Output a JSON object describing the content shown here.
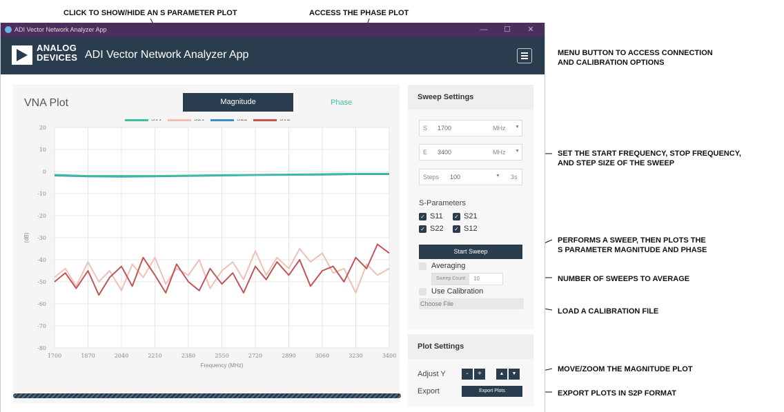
{
  "callouts": {
    "show_hide": "CLICK TO SHOW/HIDE AN S PARAMETER PLOT",
    "phase": "ACCESS THE PHASE PLOT",
    "menu": [
      "MENU BUTTON TO ACCESS CONNECTION",
      "AND CALIBRATION OPTIONS"
    ],
    "sweep_range": [
      "SET THE START FREQUENCY, STOP FREQUENCY,",
      "AND STEP SIZE OF THE SWEEP"
    ],
    "start_sweep": [
      "PERFORMS A SWEEP, THEN PLOTS THE",
      "S PARAMETER MAGNITUDE AND PHASE"
    ],
    "sweep_count": "NUMBER OF SWEEPS TO AVERAGE",
    "calibration": "LOAD A CALIBRATION FILE",
    "adjust_y": "MOVE/ZOOM THE MAGNITUDE PLOT",
    "export": "EXPORT PLOTS IN S2P FORMAT"
  },
  "window": {
    "title": "ADI Vector Network Analyzer App",
    "controls": {
      "minimize": "—",
      "maximize": "☐",
      "close": "✕"
    }
  },
  "header": {
    "logo_line1": "ANALOG",
    "logo_line2": "DEVICES",
    "title": "ADI Vector Network Analyzer App"
  },
  "plot": {
    "title": "VNA Plot",
    "tabs": {
      "magnitude": "Magnitude",
      "phase": "Phase"
    }
  },
  "sweep_settings": {
    "title": "Sweep Settings",
    "start": {
      "prefix": "S",
      "value": "1700",
      "unit": "MHz"
    },
    "end": {
      "prefix": "E",
      "value": "3400",
      "unit": "MHz"
    },
    "steps": {
      "prefix": "Steps",
      "value": "100",
      "time": "3s"
    },
    "sparams_label": "S-Parameters",
    "sparams": [
      "S11",
      "S21",
      "S22",
      "S12"
    ],
    "start_sweep": "Start Sweep",
    "averaging": "Averaging",
    "sweep_count_label": "Sweep Count",
    "sweep_count_value": "10",
    "use_calibration": "Use Calibration",
    "choose_file": "Choose File"
  },
  "plot_settings": {
    "title": "Plot Settings",
    "adjust_y": "Adjust Y",
    "export": "Export",
    "export_button": "Export Plots",
    "minus": "-",
    "plus": "+",
    "up": "▲",
    "down": "▼"
  },
  "colors": {
    "S11": "#3bbf9f",
    "S21": "#eec0b6",
    "S22": "#3a8fc9",
    "S12": "#c25454",
    "header": "#2a3d4f",
    "titlebar": "#4d2d5d",
    "phase_tab": "#3bbf9f"
  },
  "chart_data": {
    "type": "line",
    "xlabel": "Frequency (MHz)",
    "ylabel": "(dB)",
    "x_ticks": [
      1700,
      1870,
      2040,
      2210,
      2380,
      2550,
      2720,
      2890,
      3060,
      3230,
      3400
    ],
    "y_ticks": [
      20,
      10,
      0,
      -10,
      -20,
      -30,
      -40,
      -50,
      -60,
      -70,
      -80
    ],
    "xlim": [
      1700,
      3400
    ],
    "ylim": [
      -80,
      20
    ],
    "grid": true,
    "legend_position": "top",
    "series": [
      {
        "name": "S11",
        "color": "#3bbf9f",
        "x": [
          1700,
          1870,
          2040,
          2210,
          2380,
          2550,
          2720,
          2890,
          3060,
          3230,
          3400
        ],
        "y": [
          -1.5,
          -2,
          -2,
          -2,
          -1.8,
          -1.6,
          -1.5,
          -1.3,
          -1.2,
          -1,
          -1
        ]
      },
      {
        "name": "S21",
        "color": "#eec0b6",
        "x": [
          1700,
          1755,
          1810,
          1870,
          1925,
          1980,
          2040,
          2095,
          2150,
          2210,
          2265,
          2320,
          2380,
          2435,
          2490,
          2550,
          2605,
          2660,
          2720,
          2775,
          2830,
          2890,
          2945,
          3000,
          3060,
          3115,
          3170,
          3230,
          3285,
          3340,
          3400
        ],
        "y": [
          -48,
          -44,
          -52,
          -41,
          -50,
          -45,
          -54,
          -42,
          -48,
          -39,
          -51,
          -44,
          -47,
          -40,
          -53,
          -45,
          -41,
          -49,
          -36,
          -47,
          -39,
          -44,
          -35,
          -41,
          -37,
          -46,
          -44,
          -55,
          -42,
          -47,
          -44
        ]
      },
      {
        "name": "S22",
        "color": "#3a8fc9",
        "x": [
          1700,
          1870,
          2040,
          2210,
          2380,
          2550,
          2720,
          2890,
          3060,
          3230,
          3400
        ],
        "y": [
          -1.8,
          -2.2,
          -2.3,
          -2.2,
          -2,
          -1.8,
          -1.6,
          -1.5,
          -1.4,
          -1.2,
          -1.2
        ]
      },
      {
        "name": "S12",
        "color": "#c25454",
        "x": [
          1700,
          1755,
          1810,
          1870,
          1925,
          1980,
          2040,
          2095,
          2150,
          2210,
          2265,
          2320,
          2380,
          2435,
          2490,
          2550,
          2605,
          2660,
          2720,
          2775,
          2830,
          2890,
          2945,
          3000,
          3060,
          3115,
          3170,
          3230,
          3285,
          3340,
          3400
        ],
        "y": [
          -50,
          -46,
          -53,
          -45,
          -56,
          -48,
          -43,
          -52,
          -39,
          -47,
          -55,
          -42,
          -50,
          -54,
          -44,
          -51,
          -46,
          -55,
          -43,
          -49,
          -41,
          -47,
          -40,
          -52,
          -45,
          -43,
          -50,
          -39,
          -44,
          -33,
          -37
        ]
      }
    ]
  }
}
